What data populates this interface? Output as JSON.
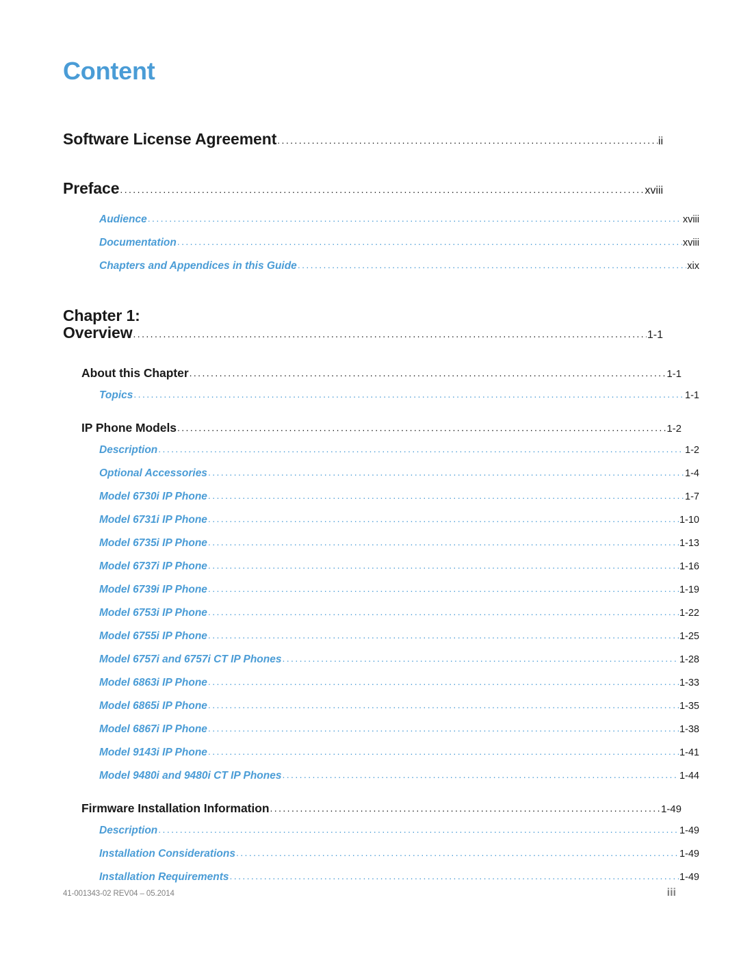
{
  "document": {
    "title": "Content",
    "title_color": "#4A9CD6",
    "body_color": "#1a1a1a"
  },
  "toc": {
    "entries": [
      {
        "level": 1,
        "label": "Software License Agreement",
        "page": "ii"
      },
      {
        "level": 1,
        "label": "Preface",
        "page": "xviii"
      },
      {
        "level": 3,
        "label": "Audience",
        "page": "xviii"
      },
      {
        "level": 3,
        "label": "Documentation",
        "page": "xviii"
      },
      {
        "level": 3,
        "label": "Chapters and Appendices in this Guide",
        "page": "xix"
      },
      {
        "level": 1,
        "label": "Overview",
        "page": "1-1",
        "prefix": "Chapter 1:"
      },
      {
        "level": 2,
        "label": "About this Chapter",
        "page": "1-1"
      },
      {
        "level": 3,
        "label": "Topics",
        "page": "1-1"
      },
      {
        "level": 2,
        "label": "IP Phone Models",
        "page": "1-2"
      },
      {
        "level": 3,
        "label": "Description",
        "page": "1-2"
      },
      {
        "level": 3,
        "label": "Optional Accessories",
        "page": "1-4"
      },
      {
        "level": 3,
        "label": "Model 6730i IP Phone",
        "page": "1-7"
      },
      {
        "level": 3,
        "label": "Model 6731i IP Phone",
        "page": "1-10"
      },
      {
        "level": 3,
        "label": "Model 6735i IP Phone",
        "page": "1-13"
      },
      {
        "level": 3,
        "label": "Model 6737i IP Phone",
        "page": "1-16"
      },
      {
        "level": 3,
        "label": "Model 6739i IP Phone",
        "page": "1-19"
      },
      {
        "level": 3,
        "label": "Model 6753i IP Phone",
        "page": "1-22"
      },
      {
        "level": 3,
        "label": "Model 6755i IP Phone",
        "page": "1-25"
      },
      {
        "level": 3,
        "label": "Model 6757i and 6757i CT IP Phones",
        "page": "1-28"
      },
      {
        "level": 3,
        "label": "Model 6863i IP Phone",
        "page": "1-33"
      },
      {
        "level": 3,
        "label": "Model 6865i IP Phone",
        "page": "1-35"
      },
      {
        "level": 3,
        "label": "Model 6867i IP Phone",
        "page": "1-38"
      },
      {
        "level": 3,
        "label": "Model 9143i IP Phone",
        "page": "1-41"
      },
      {
        "level": 3,
        "label": "Model 9480i and 9480i CT IP Phones",
        "page": "1-44"
      },
      {
        "level": 2,
        "label": "Firmware Installation Information",
        "page": "1-49"
      },
      {
        "level": 3,
        "label": "Description",
        "page": "1-49"
      },
      {
        "level": 3,
        "label": "Installation Considerations",
        "page": "1-49"
      },
      {
        "level": 3,
        "label": "Installation Requirements",
        "page": "1-49"
      }
    ],
    "leader_char": "."
  },
  "footer": {
    "document_id": "41-001343-02 REV04 – 05.2014",
    "page_number": "iii"
  }
}
